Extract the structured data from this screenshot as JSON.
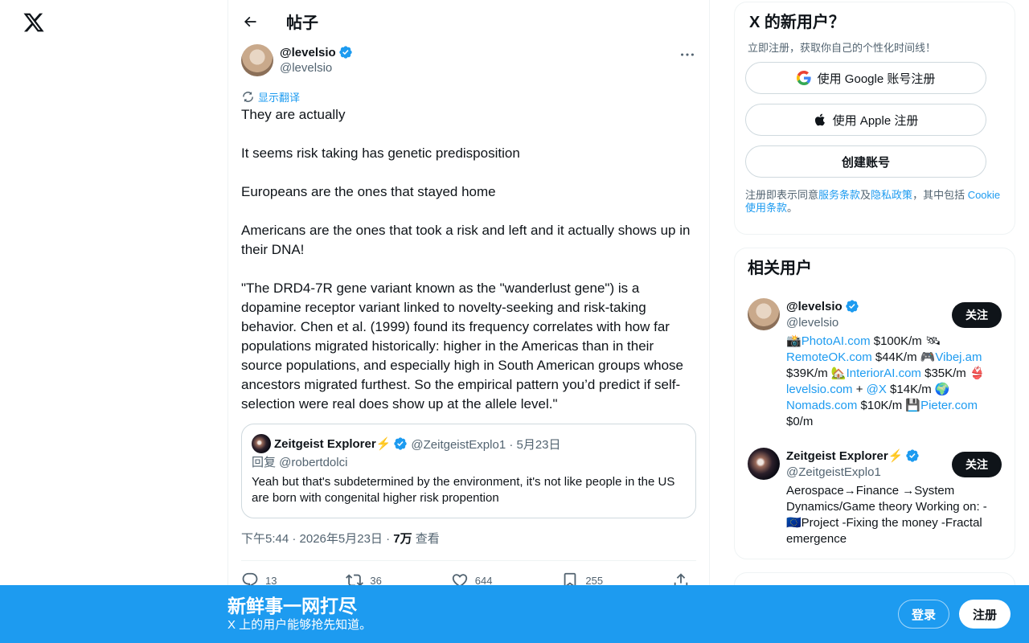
{
  "header": {
    "title": "帖子"
  },
  "tweet": {
    "author_name": "@levelsio",
    "author_handle": "@levelsio",
    "translate_label": "显示翻译",
    "paragraphs": [
      "They are actually",
      "It seems risk taking has genetic predisposition",
      "Europeans are the ones that stayed home",
      "Americans are the ones that took a risk and left and it actually shows up in their DNA!",
      "\"The DRD4-7R gene variant known as the \"wanderlust gene\") is a dopamine receptor variant linked to novelty-seeking and risk-taking behavior. Chen et al. (1999) found its frequency correlates with how far populations migrated historically: higher in the Americas than in their source populations, and especially high in South American groups whose ancestors migrated furthest. So the empirical pattern you’d predict if self-selection were real does show up at the allele level.\""
    ],
    "quote": {
      "name": "Zeitgeist Explorer⚡️",
      "handle_date": "@ZeitgeistExplo1 · 5月23日",
      "reply_to": "回复 @robertdolci",
      "text": "Yeah but that's subdetermined by the environment, it's not like people in the US are born with congenital higher risk propention"
    },
    "time": "下午5:44 · 2026年5月23日 · ",
    "views_count": "7万",
    "views_label": " 查看",
    "stats": {
      "replies": "13",
      "reposts": "36",
      "likes": "644",
      "bookmarks": "255"
    }
  },
  "signup_card": {
    "title": "X 的新用户？",
    "subtitle": "立即注册，获取你自己的个性化时间线！",
    "google_label": "使用 Google 账号注册",
    "apple_label": "使用 Apple 注册",
    "create_label": "创建账号",
    "terms_prefix": "注册即表示同意",
    "terms_link": "服务条款",
    "terms_and": "及",
    "privacy_link": "隐私政策",
    "terms_mid": "，其中包括 ",
    "cookie_link": "Cookie 使用条款",
    "terms_end": "。"
  },
  "related": {
    "title": "相关用户",
    "users": [
      {
        "name": "@levelsio",
        "handle": "@levelsio",
        "follow": "关注"
      },
      {
        "name": "Zeitgeist Explorer⚡️",
        "handle": "@ZeitgeistExplo1",
        "follow": "关注",
        "bio": "Aerospace→Finance →System Dynamics/Game theory Working on: -🇪🇺Project -Fixing the money -Fractal emergence"
      }
    ],
    "bio1": {
      "e1": "📸",
      "l1": "PhotoAI.com",
      "t1": " $100K/m ",
      "e2": "🛰",
      "l2": "RemoteOK.com",
      "t2": " $44K/m ",
      "e3": "🎮",
      "l3": "Vibej.am",
      "t3": " $39K/m ",
      "e4": "🏡",
      "l4": "InteriorAI.com",
      "t4": " $35K/m ",
      "e5": "👙",
      "l5": "levelsio.com",
      "t5": " + ",
      "l6": "@X",
      "t6": " $14K/m ",
      "e6": "🌍",
      "l7": "Nomads.com",
      "t7": " $10K/m ",
      "e7": "💾",
      "l8": "Pieter.com",
      "t8": " $0/m"
    }
  },
  "banner": {
    "title": "新鲜事一网打尽",
    "subtitle": "X 上的用户能够抢先知道。",
    "login": "登录",
    "signup": "注册"
  }
}
